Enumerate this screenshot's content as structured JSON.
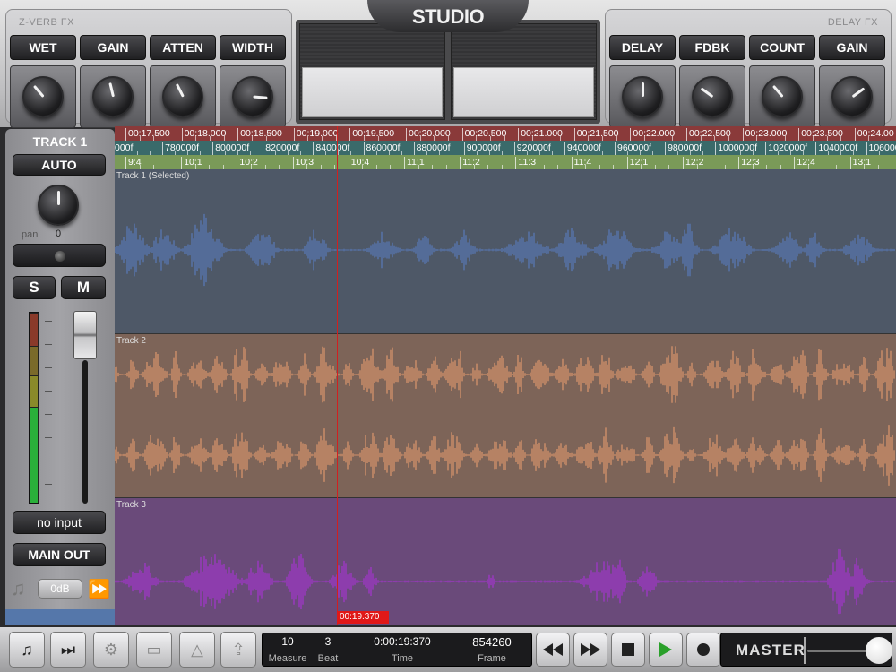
{
  "header": {
    "logo": "STUDIO",
    "left_fx": {
      "title": "Z-VERB FX",
      "controls": [
        {
          "label": "WET",
          "level": 0.35
        },
        {
          "label": "GAIN",
          "level": 0.45
        },
        {
          "label": "ATTEN",
          "level": 0.4
        },
        {
          "label": "WIDTH",
          "level": 0.85
        }
      ]
    },
    "right_fx": {
      "title": "DELAY FX",
      "controls": [
        {
          "label": "DELAY",
          "level": 0.5
        },
        {
          "label": "FDBK",
          "level": 0.3
        },
        {
          "label": "COUNT",
          "level": 0.35
        },
        {
          "label": "GAIN",
          "level": 0.7
        }
      ]
    }
  },
  "strip": {
    "track_title": "TRACK 1",
    "auto_label": "AUTO",
    "pan_label": "pan",
    "pan_value": "0",
    "solo_label": "S",
    "mute_label": "M",
    "input_label": "no input",
    "output_label": "MAIN OUT",
    "db_label": "0dB",
    "note_icon": "music-note-icon",
    "ff_icon": "fast-forward-icon"
  },
  "ruler": {
    "time_labels": [
      "00:17.500",
      "00:18.000",
      "00:18.500",
      "00:19.000",
      "00:19.500",
      "00:20.000",
      "00:20.500",
      "00:21.000",
      "00:21.500",
      "00:22.000",
      "00:22.500",
      "00:23.000",
      "00:23.500",
      "00:24.00"
    ],
    "frame_labels": [
      "000f",
      "780000f",
      "800000f",
      "820000f",
      "840000f",
      "860000f",
      "880000f",
      "900000f",
      "920000f",
      "940000f",
      "960000f",
      "980000f",
      "1000000f",
      "1020000f",
      "1040000f",
      "1060000"
    ],
    "beat_labels": [
      "9:4",
      "10:1",
      "10:2",
      "10:3",
      "10:4",
      "11:1",
      "11:2",
      "11:3",
      "11:4",
      "12:1",
      "12:2",
      "12:3",
      "12:4",
      "13:1"
    ]
  },
  "tracks": [
    {
      "name": "Track 1 (Selected)",
      "color": "#5a7fc8"
    },
    {
      "name": "Track 2",
      "color": "#f0a070"
    },
    {
      "name": "Track 3",
      "color": "#b030e0"
    }
  ],
  "playhead": {
    "label": "00:19.370"
  },
  "transport": {
    "buttons": [
      "music-note-icon",
      "skip-forward-icon",
      "gear-icon",
      "folder-icon",
      "metronome-icon",
      "share-icon"
    ],
    "counter": {
      "measure": "10",
      "measure_label": "Measure",
      "beat": "3",
      "beat_label": "Beat",
      "time": "0:00:19:370",
      "time_label": "Time",
      "frame": "854260",
      "frame_label": "Frame"
    },
    "play_buttons": [
      "rewind-icon",
      "fast-forward-icon",
      "stop-icon",
      "play-icon",
      "record-icon"
    ],
    "master_label": "MASTER",
    "master_level": 0.95
  },
  "colors": {
    "play_accent": "#2aa02a",
    "playhead": "#d02020"
  }
}
